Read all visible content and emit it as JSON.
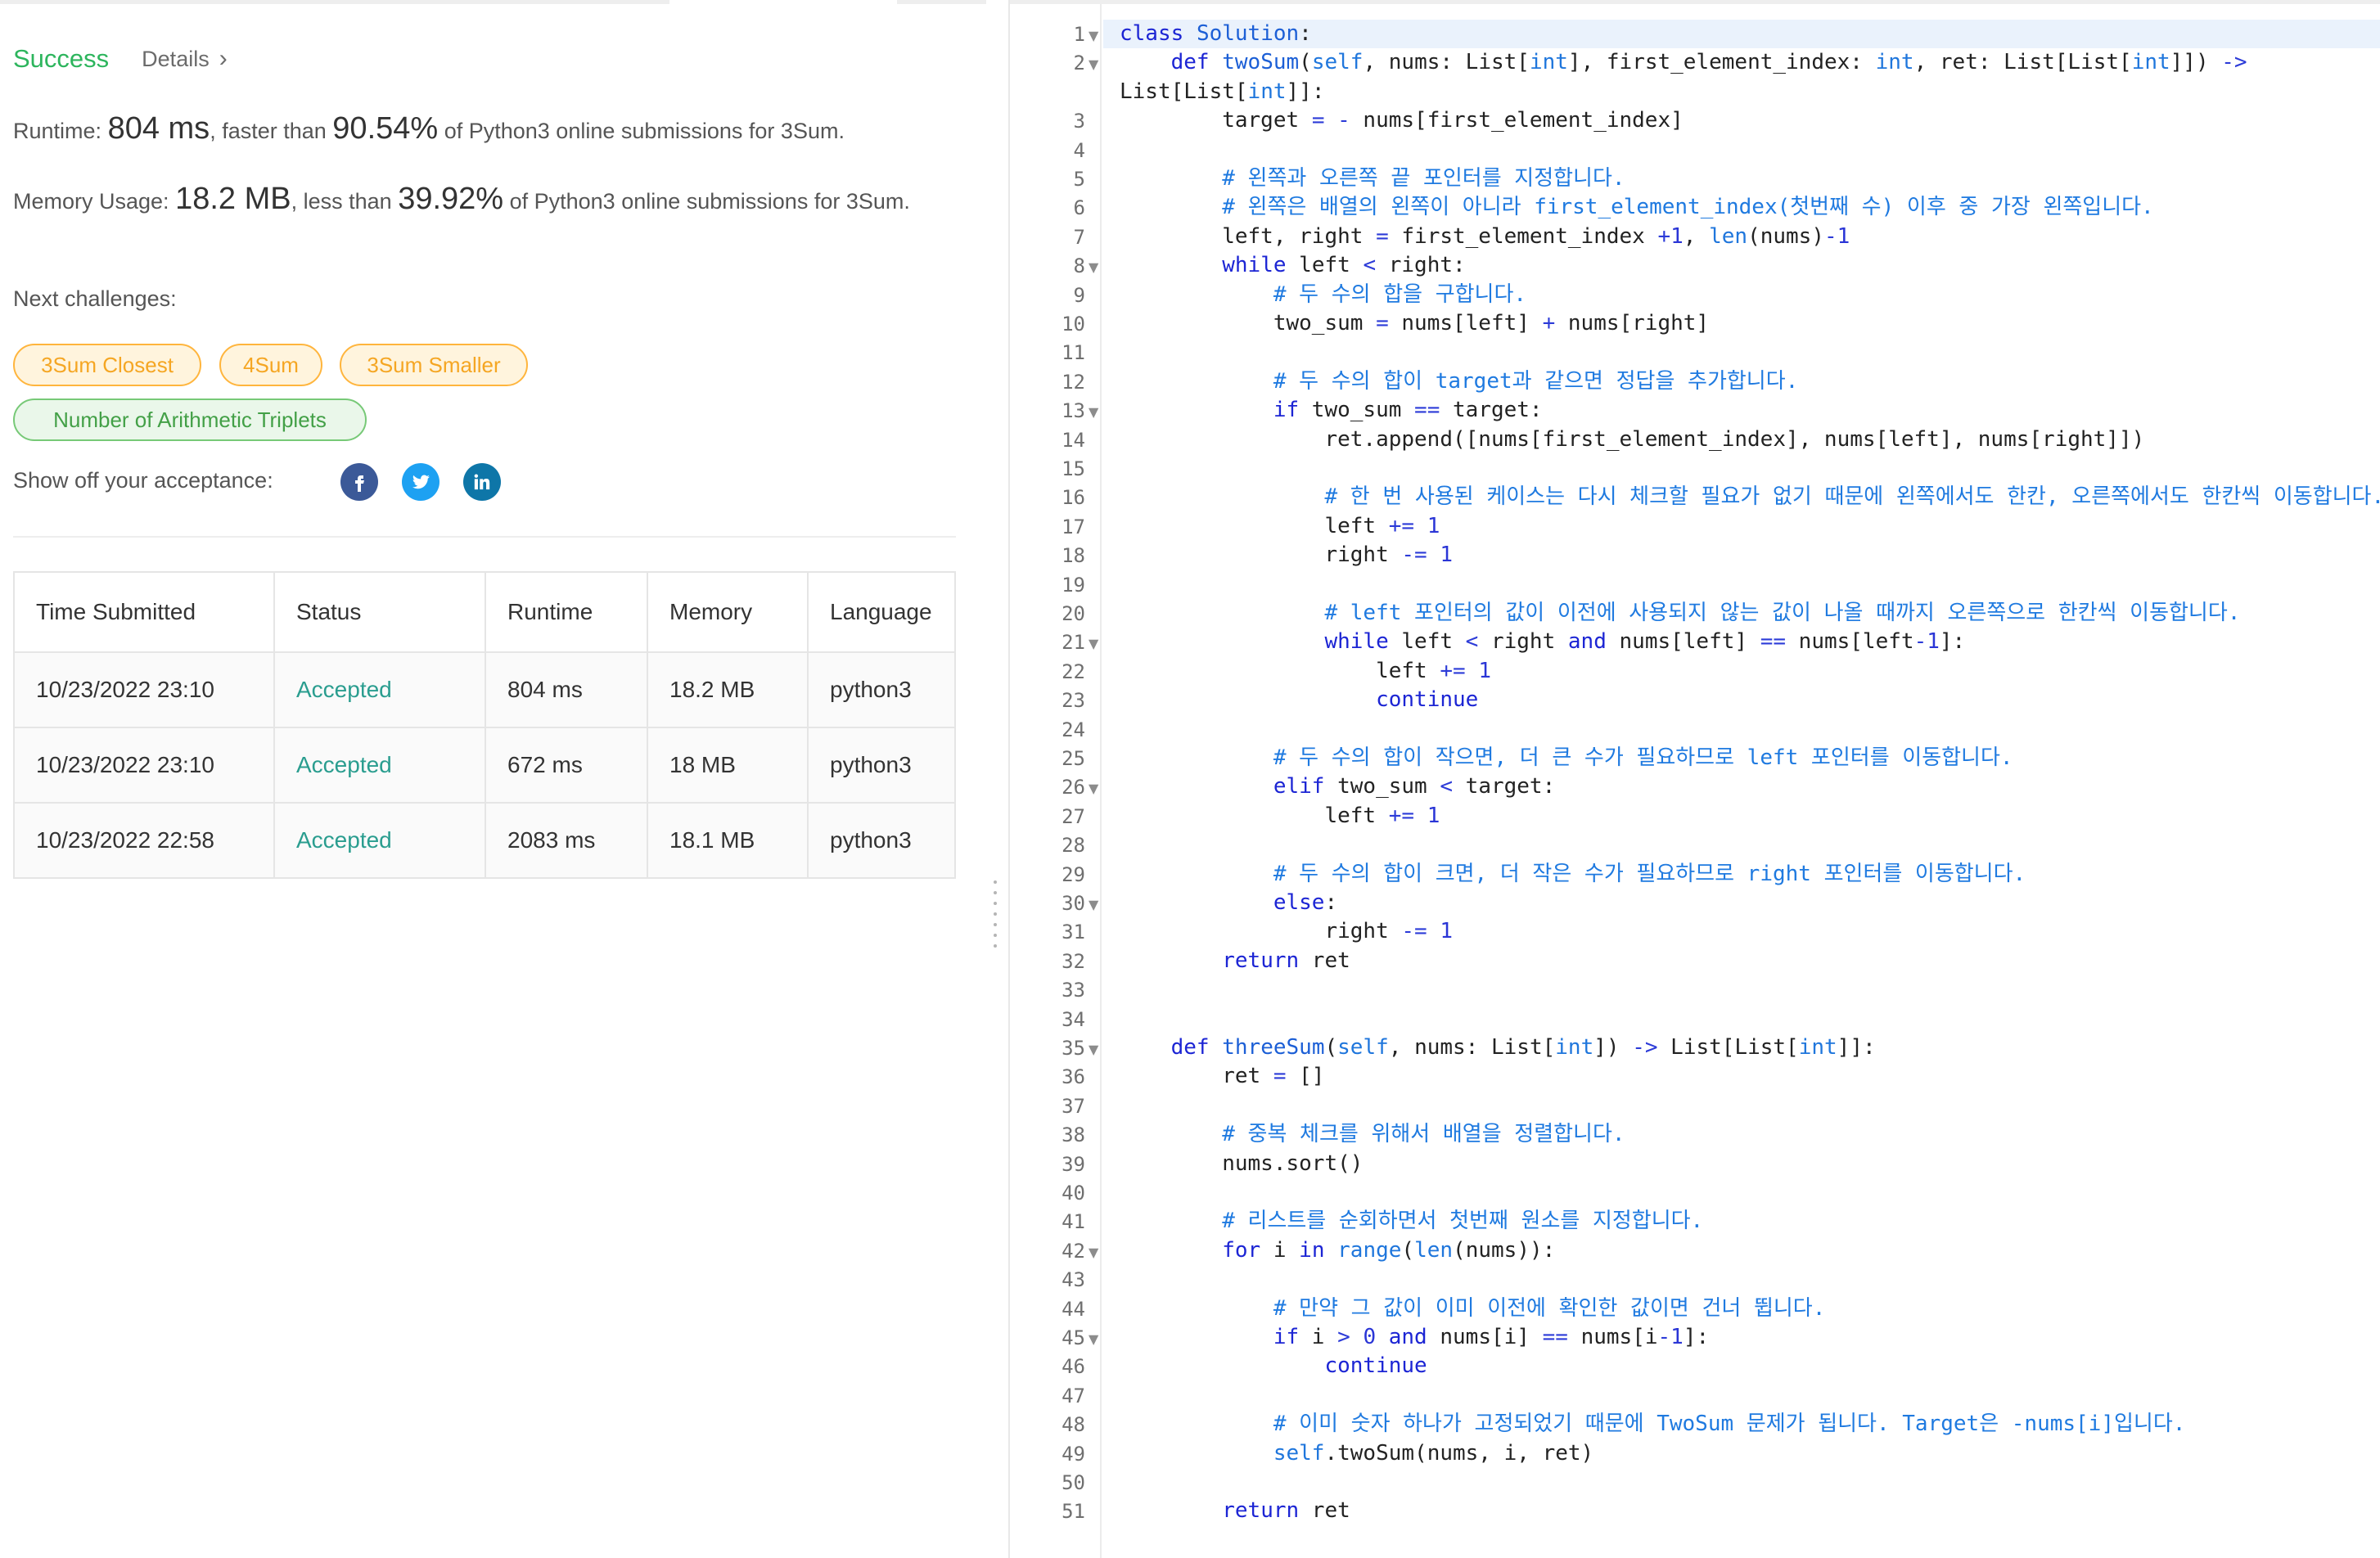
{
  "result": {
    "status": "Success",
    "details_label": "Details",
    "runtime_label": "Runtime:",
    "runtime_value": "804 ms",
    "runtime_mid": ", faster than",
    "runtime_pct": "90.54%",
    "runtime_suffix": "of Python3 online submissions for 3Sum.",
    "memory_label": "Memory Usage:",
    "memory_value": "18.2 MB",
    "memory_mid": ", less than",
    "memory_pct": "39.92%",
    "memory_suffix": "of Python3 online submissions for 3Sum."
  },
  "next": {
    "label": "Next challenges:",
    "tags": [
      "3Sum Closest",
      "4Sum",
      "3Sum Smaller",
      "Number of Arithmetic Triplets"
    ]
  },
  "share": {
    "label": "Show off your acceptance:",
    "icons": [
      "facebook-icon",
      "twitter-icon",
      "linkedin-icon"
    ]
  },
  "table": {
    "headers": [
      "Time Submitted",
      "Status",
      "Runtime",
      "Memory",
      "Language"
    ],
    "rows": [
      [
        "10/23/2022 23:10",
        "Accepted",
        "804 ms",
        "18.2 MB",
        "python3"
      ],
      [
        "10/23/2022 23:10",
        "Accepted",
        "672 ms",
        "18 MB",
        "python3"
      ],
      [
        "10/23/2022 22:58",
        "Accepted",
        "2083 ms",
        "18.1 MB",
        "python3"
      ]
    ]
  },
  "colors": {
    "success": "#2db55d",
    "accepted": "#2a9d8f",
    "tag_orange": "#f5a623",
    "tag_green": "#43a047",
    "keyword": "#1c25d4",
    "comment": "#1f7ae0"
  },
  "editor": {
    "code_lines": [
      "class Solution:",
      "    def twoSum(self, nums: List[int], first_element_index: int, ret: List[List[int]]) ->",
      "        target = - nums[first_element_index]",
      "",
      "        # 왼쪽과 오른쪽 끝 포인터를 지정합니다.",
      "        # 왼쪽은 배열의 왼쪽이 아니라 first_element_index(첫번째 수) 이후 중 가장 왼쪽입니다.",
      "        left, right = first_element_index +1, len(nums)-1",
      "        while left < right:",
      "            # 두 수의 합을 구합니다.",
      "            two_sum = nums[left] + nums[right]",
      "",
      "            # 두 수의 합이 target과 같으면 정답을 추가합니다.",
      "            if two_sum == target:",
      "                ret.append([nums[first_element_index], nums[left], nums[right]])",
      "",
      "                # 한 번 사용된 케이스는 다시 체크할 필요가 없기 때문에 왼쪽에서도 한칸, 오른쪽에서도 한칸씩 이동합니다.",
      "                left += 1",
      "                right -= 1",
      "",
      "                # left 포인터의 값이 이전에 사용되지 않는 값이 나올 때까지 오른쪽으로 한칸씩 이동합니다.",
      "                while left < right and nums[left] == nums[left-1]:",
      "                    left += 1",
      "                    continue",
      "",
      "            # 두 수의 합이 작으면, 더 큰 수가 필요하므로 left 포인터를 이동합니다.",
      "            elif two_sum < target:",
      "                left += 1",
      "",
      "            # 두 수의 합이 크면, 더 작은 수가 필요하므로 right 포인터를 이동합니다.",
      "            else:",
      "                right -= 1",
      "        return ret",
      "",
      "",
      "    def threeSum(self, nums: List[int]) -> List[List[int]]:",
      "        ret = []",
      "",
      "        # 중복 체크를 위해서 배열을 정렬합니다.",
      "        nums.sort()",
      "",
      "        # 리스트를 순회하면서 첫번째 원소를 지정합니다.",
      "        for i in range(len(nums)):",
      "",
      "            # 만약 그 값이 이미 이전에 확인한 값이면 건너 뜁니다.",
      "            if i > 0 and nums[i] == nums[i-1]:",
      "                continue",
      "",
      "            # 이미 숫자 하나가 고정되었기 때문에 TwoSum 문제가 됩니다. Target은 -nums[i]입니다.",
      "            self.twoSum(nums, i, ret)",
      "",
      "        return ret"
    ],
    "wrap_continuation": "List[List[int]]:",
    "fold_lines": [
      1,
      2,
      8,
      13,
      21,
      26,
      30,
      35,
      42,
      45
    ],
    "line_count": 51
  }
}
